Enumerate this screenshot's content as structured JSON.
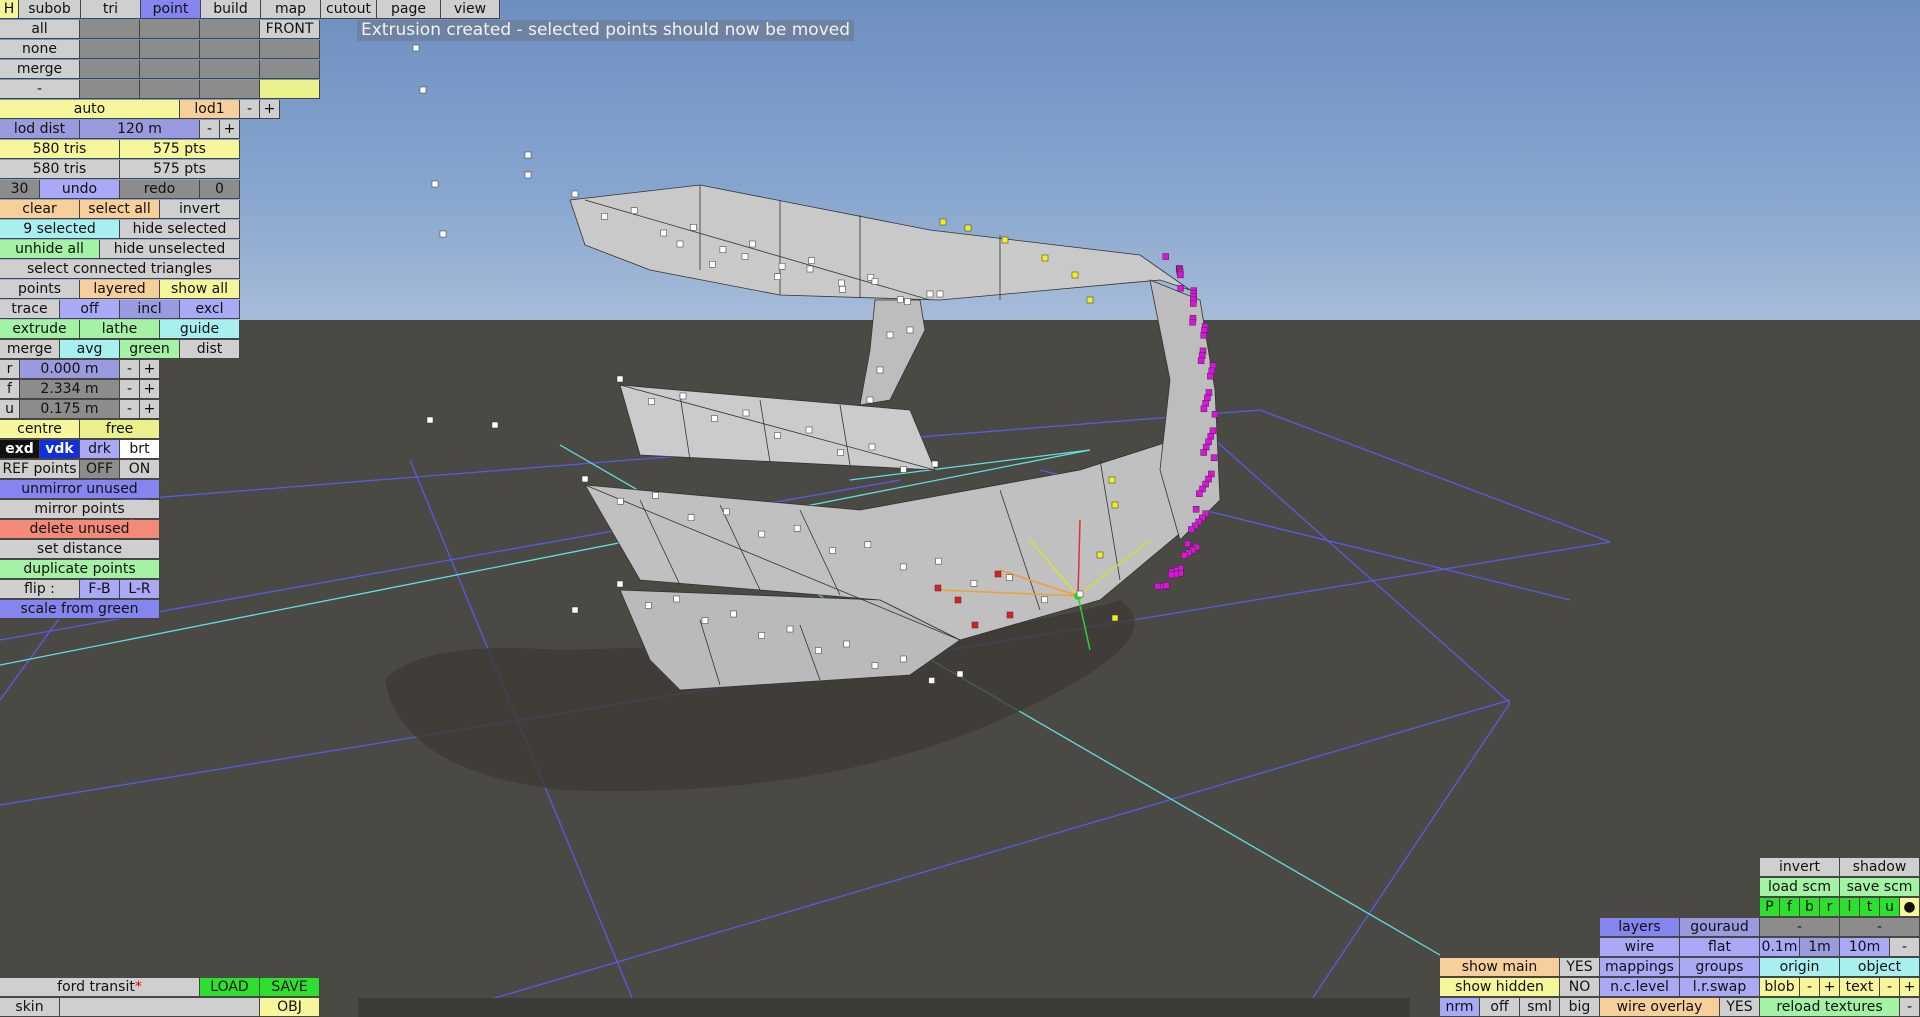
{
  "status_message": "Extrusion created - selected points should now be moved",
  "top_tabs": [
    "H",
    "subob",
    "tri",
    "point",
    "build",
    "map",
    "cutout",
    "page",
    "view"
  ],
  "mode_buttons": {
    "all": "all",
    "none": "none",
    "merge": "merge",
    "dash": "-",
    "front": "FRONT"
  },
  "lod": {
    "auto": "auto",
    "lod1": "lod1",
    "minus": "-",
    "plus": "+",
    "dist_label": "lod dist",
    "dist_value": "120 m"
  },
  "counts": {
    "tris1": "580 tris",
    "pts1": "575 pts",
    "tris2": "580 tris",
    "pts2": "575 pts"
  },
  "history": {
    "num": "30",
    "undo": "undo",
    "redo": "redo",
    "zero": "0"
  },
  "selection": {
    "clear": "clear",
    "select_all": "select all",
    "invert": "invert",
    "selected": "9 selected",
    "hide_selected": "hide selected",
    "unhide_all": "unhide all",
    "hide_unselected": "hide unselected",
    "select_connected": "select connected triangles"
  },
  "points_row": {
    "points": "points",
    "layered": "layered",
    "show_all": "show all"
  },
  "trace_row": {
    "trace": "trace",
    "off": "off",
    "incl": "incl",
    "excl": "excl"
  },
  "tools_row": {
    "extrude": "extrude",
    "lathe": "lathe",
    "guide": "guide"
  },
  "merge_row": {
    "merge": "merge",
    "avg": "avg",
    "green": "green",
    "dist": "dist"
  },
  "coords": [
    {
      "label": "r",
      "value": "0.000 m"
    },
    {
      "label": "f",
      "value": "2.334 m"
    },
    {
      "label": "u",
      "value": "0.175 m"
    }
  ],
  "centre_row": {
    "centre": "centre",
    "free": "free"
  },
  "shade_row": {
    "exd": "exd",
    "vdk": "vdk",
    "drk": "drk",
    "brt": "brt"
  },
  "ref_row": {
    "label": "REF points",
    "off": "OFF",
    "on": "ON"
  },
  "actions": {
    "unmirror": "unmirror unused",
    "mirror": "mirror points",
    "delete": "delete unused",
    "set_distance": "set distance",
    "duplicate": "duplicate points",
    "flip": "flip :",
    "fb": "F-B",
    "lr": "L-R",
    "scale": "scale from green"
  },
  "file": {
    "name": "ford transit",
    "modified": "*",
    "load": "LOAD",
    "save": "SAVE",
    "skin": "skin",
    "obj": "OBJ"
  },
  "right_panel": {
    "invert": "invert",
    "shadow": "shadow",
    "load_scm": "load scm",
    "save_scm": "save scm",
    "channels": [
      "P",
      "f",
      "b",
      "r",
      "l",
      "t",
      "u"
    ],
    "dot": "●",
    "dash1": "-",
    "dash2": "-",
    "layers": "layers",
    "gouraud": "gouraud",
    "wire": "wire",
    "flat": "flat",
    "mappings": "mappings",
    "groups": "groups",
    "nclevel": "n.c.level",
    "lrswap": "l.r.swap",
    "show_main": "show main",
    "show_main_val": "YES",
    "show_hidden": "show hidden",
    "show_hidden_val": "NO",
    "nrm": "nrm",
    "off": "off",
    "sml": "sml",
    "big": "big",
    "wire_overlay": "wire overlay",
    "wire_overlay_val": "YES",
    "scale_a": "0.1m",
    "scale_b": "1m",
    "scale_c": "10m",
    "scale_minus": "-",
    "origin": "origin",
    "object": "object",
    "blob": "blob",
    "text": "text",
    "minus": "-",
    "plus": "+",
    "reload": "reload textures",
    "reload_minus": "-"
  },
  "colors": {
    "selected_point": "#e010e0",
    "yellow_point": "#f0f020",
    "red_point": "#e02020",
    "green_point": "#20e020",
    "grid": "#5a5ae6",
    "axis": "#60e0e0"
  }
}
